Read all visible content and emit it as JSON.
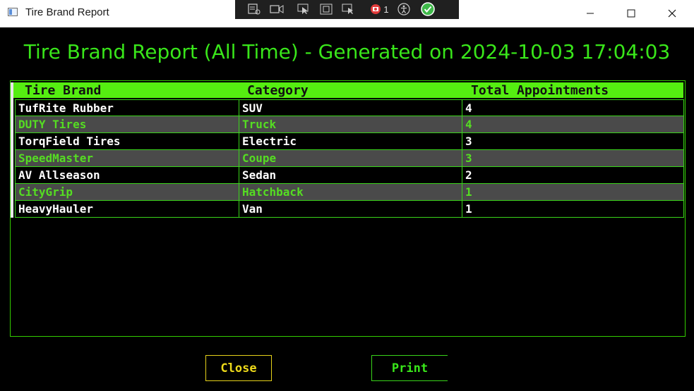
{
  "window": {
    "title": "Tire Brand Report",
    "controls": [
      "minimize-icon",
      "maximize-icon",
      "close-icon"
    ]
  },
  "debug_toolbar": {
    "icons": [
      "live-visual-tree-icon",
      "record-icon",
      "select-element-icon",
      "display-layout-adorners-icon",
      "track-focus-icon",
      "binding-failures-icon",
      "accessibility-icon",
      "hot-reload-ok-icon"
    ],
    "binding_failure_count": "1"
  },
  "report": {
    "heading": "Tire Brand Report (All Time) - Generated on 2024-10-03 17:04:03",
    "columns": [
      "Tire Brand",
      "Category",
      "Total Appointments"
    ],
    "rows": [
      [
        "TufRite Rubber",
        "SUV",
        "4"
      ],
      [
        "DUTY Tires",
        "Truck",
        "4"
      ],
      [
        "TorqField Tires",
        "Electric",
        "3"
      ],
      [
        "SpeedMaster",
        "Coupe",
        "3"
      ],
      [
        "AV Allseason",
        "Sedan",
        "2"
      ],
      [
        "CityGrip",
        "Hatchback",
        "1"
      ],
      [
        "HeavyHauler",
        "Van",
        "1"
      ]
    ]
  },
  "buttons": {
    "close_label": "Close",
    "print_label": "Print"
  },
  "colors": {
    "background": "#000000",
    "accent_green": "#39e61a",
    "header_green": "#55ee11",
    "alt_row": "#4a4a4a",
    "close_yellow": "#ecd81a"
  }
}
